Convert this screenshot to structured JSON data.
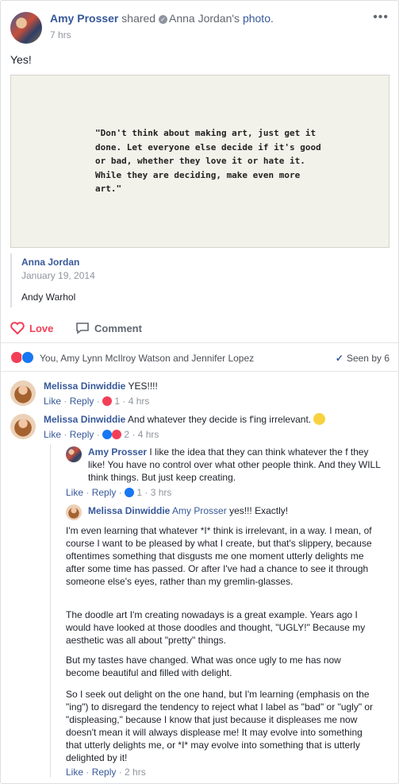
{
  "header": {
    "author": "Amy Prosser",
    "shared_text": "shared",
    "shared_from": "Anna Jordan's",
    "photo_text": "photo.",
    "time": "7 hrs",
    "more": "•••"
  },
  "post_text": "Yes!",
  "image": {
    "quote": "\"Don't think about making art, just get it done. Let everyone else decide if it's good or bad, whether they love it or hate it. While they are deciding, make even more art.\""
  },
  "attribution": {
    "name": "Anna Jordan",
    "date": "January 19, 2014",
    "text": "Andy Warhol"
  },
  "actions": {
    "love": "Love",
    "comment": "Comment"
  },
  "reactions": {
    "text": "You, Amy Lynn McIlroy Watson and Jennifer Lopez",
    "seen_by": "Seen by 6"
  },
  "comments": [
    {
      "name": "Melissa Dinwiddie",
      "text": "YES!!!!",
      "like": "Like",
      "reply": "Reply",
      "count": "1",
      "time": "4 hrs"
    },
    {
      "name": "Melissa Dinwiddie",
      "text": "And whatever they decide is f'ing irrelevant.",
      "like": "Like",
      "reply": "Reply",
      "count": "2",
      "time": "4 hrs"
    },
    {
      "name": "Amy Prosser",
      "text": "I like the idea that they can think whatever the f they like! You have no control over what other people think. And they WILL think things. But just keep creating.",
      "like": "Like",
      "reply": "Reply",
      "count": "1",
      "time": "3 hrs"
    },
    {
      "name": "Melissa Dinwiddie",
      "mention": "Amy Prosser",
      "text": "yes!!! Exactly!",
      "p1": "I'm even learning that whatever *I* think is irrelevant, in a way. I mean, of course I want to be pleased by what I create, but that's slippery, because oftentimes something that disgusts me one moment utterly delights me after some time has passed. Or after I've had a chance to see it through someone else's eyes, rather than my gremlin-glasses.",
      "p2": "The doodle art I'm creating nowadays is a great example. Years ago I would have looked at those doodles and thought, \"UGLY!\" Because my aesthetic was all about \"pretty\" things.",
      "p3": "But my tastes have changed. What was once ugly to me has now become beautiful and filled with delight.",
      "p4": "So I seek out delight on the one hand, but I'm learning (emphasis on the \"ing\") to disregard the tendency to reject what I label as \"bad\" or \"ugly\" or \"displeasing,\" because I know that just because it displeases me now doesn't mean it will always displease me! It may evolve into something that utterly delights me, or *I* may evolve into something that is utterly delighted by it!",
      "like": "Like",
      "reply": "Reply",
      "time": "2 hrs"
    }
  ]
}
